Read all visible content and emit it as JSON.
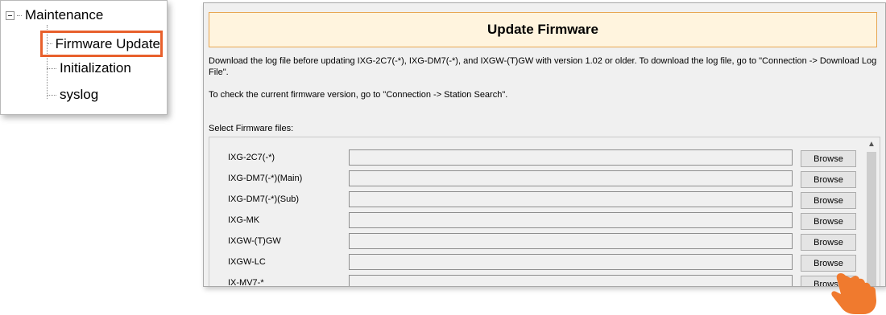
{
  "tree": {
    "root_label": "Maintenance",
    "items": [
      {
        "label": "Firmware Update",
        "selected": true
      },
      {
        "label": "Initialization",
        "selected": false
      },
      {
        "label": "syslog",
        "selected": false
      }
    ]
  },
  "main": {
    "title": "Update Firmware",
    "notice_log": "Download the log file before updating IXG-2C7(-*), IXG-DM7(-*), and IXGW-(T)GW with version 1.02 or older. To download the log file, go to \"Connection -> Download Log File\".",
    "notice_version": "To check the current firmware version, go to \"Connection -> Station Search\".",
    "select_label": "Select Firmware files:",
    "browse_label": "Browse",
    "files": [
      {
        "label": "IXG-2C7(-*)",
        "value": ""
      },
      {
        "label": "IXG-DM7(-*)(Main)",
        "value": ""
      },
      {
        "label": "IXG-DM7(-*)(Sub)",
        "value": ""
      },
      {
        "label": "IXG-MK",
        "value": ""
      },
      {
        "label": "IXGW-(T)GW",
        "value": ""
      },
      {
        "label": "IXGW-LC",
        "value": ""
      },
      {
        "label": "IX-MV7-*",
        "value": ""
      }
    ]
  },
  "colors": {
    "highlight": "#e8602c",
    "title_bg": "#fff4de",
    "title_border": "#e7a652",
    "hand": "#f07a2e"
  },
  "icons": {
    "tree_expander": "collapse-minus-icon",
    "scroll_up": "chevron-up-icon",
    "pointer": "hand-pointer-icon"
  }
}
